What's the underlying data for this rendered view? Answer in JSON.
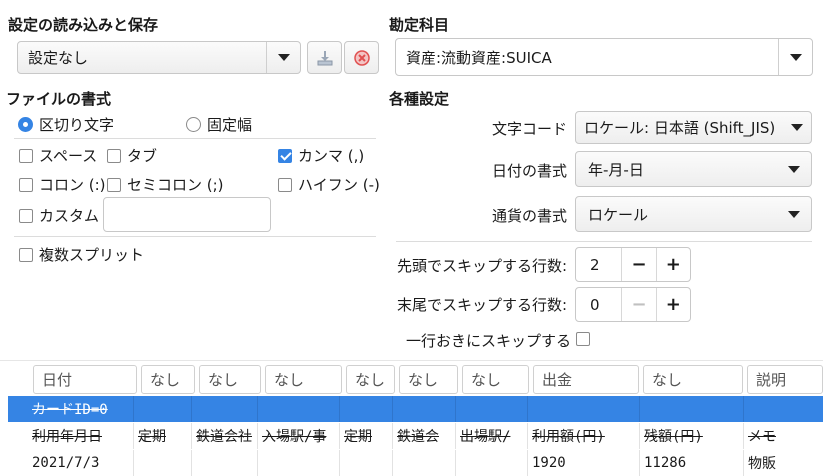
{
  "settings_io": {
    "title": "設定の読み込みと保存",
    "selected": "設定なし",
    "save_icon": "save-icon",
    "delete_icon": "delete-icon"
  },
  "account": {
    "title": "勘定科目",
    "selected": "資産:流動資産:SUICA"
  },
  "file_format": {
    "title": "ファイルの書式",
    "radio_separated": "区切り文字",
    "radio_fixed": "固定幅",
    "space": "スペース",
    "tab": "タブ",
    "comma": "カンマ (,)",
    "colon": "コロン (:)",
    "semicolon": "セミコロン (;)",
    "hyphen": "ハイフン (-)",
    "custom": "カスタム",
    "custom_value": "",
    "multi_split": "複数スプリット"
  },
  "options": {
    "title": "各種設定",
    "encoding_label": "文字コード",
    "encoding_value": "ロケール: 日本語 (Shift_JIS)",
    "date_label": "日付の書式",
    "date_value": "年-月-日",
    "currency_label": "通貨の書式",
    "currency_value": "ロケール",
    "skip_head_label": "先頭でスキップする行数:",
    "skip_head_value": "2",
    "skip_tail_label": "末尾でスキップする行数:",
    "skip_tail_value": "0",
    "skip_alt_label": "一行おきにスキップする",
    "minus": "−",
    "plus": "+"
  },
  "preview": {
    "headers": [
      "日付",
      "なし",
      "なし",
      "なし",
      "なし",
      "なし",
      "なし",
      "出金",
      "なし",
      "説明"
    ],
    "rows": [
      [
        "カードID=0",
        "",
        "",
        "",
        "",
        "",
        "",
        "",
        "",
        ""
      ],
      [
        "利用年月日",
        "定期",
        "鉄道会社",
        "入場駅/事",
        "定期",
        "鉄道会",
        "出場駅/",
        "利用額(円)",
        "残額(円)",
        "メモ"
      ],
      [
        "2021/7/3",
        "",
        "",
        "",
        "",
        "",
        "",
        "1920",
        "11286",
        "物販"
      ]
    ]
  },
  "colors": {
    "accent": "#3584e4",
    "delete": "#e05050"
  }
}
